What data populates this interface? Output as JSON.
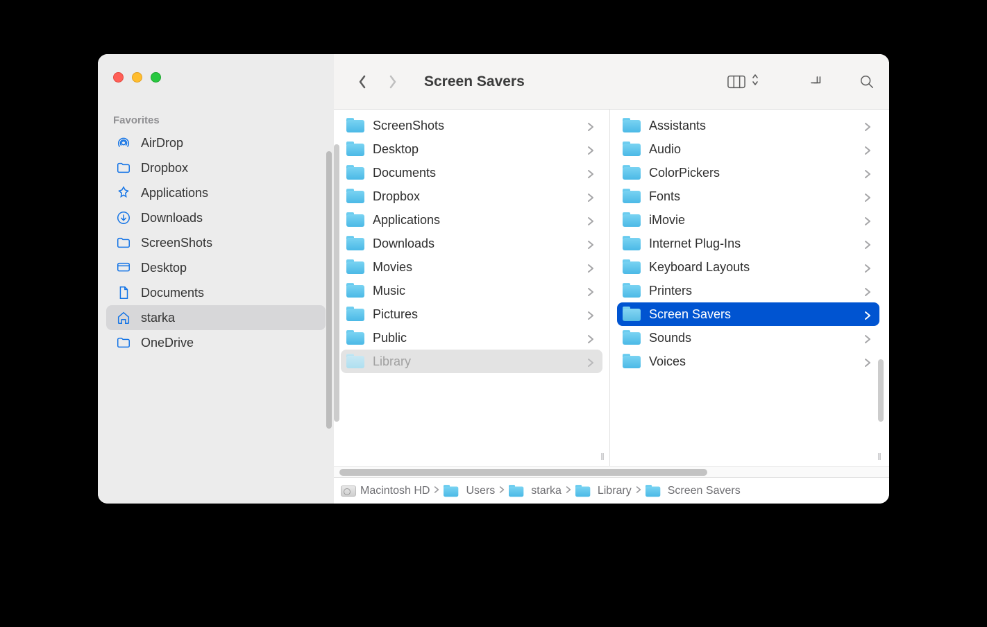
{
  "window": {
    "title": "Screen Savers"
  },
  "sidebar": {
    "header": "Favorites",
    "items": [
      {
        "label": "AirDrop",
        "icon": "airdrop",
        "selected": false
      },
      {
        "label": "Dropbox",
        "icon": "folder",
        "selected": false
      },
      {
        "label": "Applications",
        "icon": "apps",
        "selected": false
      },
      {
        "label": "Downloads",
        "icon": "download",
        "selected": false
      },
      {
        "label": "ScreenShots",
        "icon": "folder",
        "selected": false
      },
      {
        "label": "Desktop",
        "icon": "desktop",
        "selected": false
      },
      {
        "label": "Documents",
        "icon": "document",
        "selected": false
      },
      {
        "label": "starka",
        "icon": "home",
        "selected": true
      },
      {
        "label": "OneDrive",
        "icon": "folder",
        "selected": false
      }
    ]
  },
  "columns": [
    {
      "items": [
        {
          "label": "ScreenShots",
          "selected": false,
          "ghost": false
        },
        {
          "label": "Desktop",
          "selected": false,
          "ghost": false
        },
        {
          "label": "Documents",
          "selected": false,
          "ghost": false
        },
        {
          "label": "Dropbox",
          "selected": false,
          "ghost": false
        },
        {
          "label": "Applications",
          "selected": false,
          "ghost": false
        },
        {
          "label": "Downloads",
          "selected": false,
          "ghost": false
        },
        {
          "label": "Movies",
          "selected": false,
          "ghost": false
        },
        {
          "label": "Music",
          "selected": false,
          "ghost": false
        },
        {
          "label": "Pictures",
          "selected": false,
          "ghost": false
        },
        {
          "label": "Public",
          "selected": false,
          "ghost": false
        },
        {
          "label": "Library",
          "selected": false,
          "ghost": true
        }
      ]
    },
    {
      "items": [
        {
          "label": "Assistants",
          "selected": false
        },
        {
          "label": "Audio",
          "selected": false
        },
        {
          "label": "ColorPickers",
          "selected": false
        },
        {
          "label": "Fonts",
          "selected": false
        },
        {
          "label": "iMovie",
          "selected": false
        },
        {
          "label": "Internet Plug-Ins",
          "selected": false
        },
        {
          "label": "Keyboard Layouts",
          "selected": false
        },
        {
          "label": "Printers",
          "selected": false
        },
        {
          "label": "Screen Savers",
          "selected": true
        },
        {
          "label": "Sounds",
          "selected": false
        },
        {
          "label": "Voices",
          "selected": false
        }
      ]
    }
  ],
  "pathbar": [
    {
      "label": "Macintosh HD",
      "icon": "hdd"
    },
    {
      "label": "Users",
      "icon": "folder"
    },
    {
      "label": "starka",
      "icon": "folder"
    },
    {
      "label": "Library",
      "icon": "folder"
    },
    {
      "label": "Screen Savers",
      "icon": "folder"
    }
  ]
}
